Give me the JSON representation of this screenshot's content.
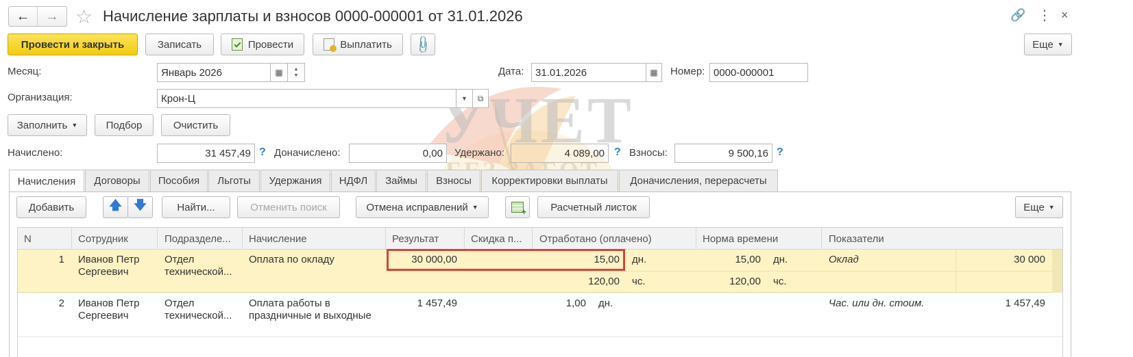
{
  "window": {
    "title": "Начисление зарплаты и взносов 0000-000001 от 31.01.2026"
  },
  "toolbar": {
    "post_close": "Провести и закрыть",
    "save": "Записать",
    "post": "Провести",
    "pay": "Выплатить",
    "more": "Еще"
  },
  "form": {
    "month_label": "Месяц:",
    "month_value": "Январь 2026",
    "date_label": "Дата:",
    "date_value": "31.01.2026",
    "number_label": "Номер:",
    "number_value": "0000-000001",
    "org_label": "Организация:",
    "org_value": "Крон-Ц"
  },
  "actions": {
    "fill": "Заполнить",
    "select": "Подбор",
    "clear": "Очистить"
  },
  "totals": {
    "accrued_label": "Начислено:",
    "accrued_value": "31 457,49",
    "extra_label": "Доначислено:",
    "extra_value": "0,00",
    "withheld_label": "Удержано:",
    "withheld_value": "4 089,00",
    "contrib_label": "Взносы:",
    "contrib_value": "9 500,16",
    "help": "?"
  },
  "tabs": [
    "Начисления",
    "Договоры",
    "Пособия",
    "Льготы",
    "Удержания",
    "НДФЛ",
    "Займы",
    "Взносы",
    "Корректировки выплаты",
    "Доначисления, перерасчеты"
  ],
  "table_toolbar": {
    "add": "Добавить",
    "find": "Найти...",
    "cancel_search": "Отменить поиск",
    "undo_fix": "Отмена исправлений",
    "payslip": "Расчетный листок",
    "more": "Еще"
  },
  "table": {
    "headers": [
      "N",
      "Сотрудник",
      "Подразделе...",
      "Начисление",
      "Результат",
      "Скидка п...",
      "Отработано (оплачено)",
      "Норма времени",
      "Показатели"
    ],
    "rows": [
      {
        "n": "1",
        "employee": [
          "Иванов Петр",
          "Сергеевич"
        ],
        "dept": [
          "Отдел",
          "технической..."
        ],
        "accrual": [
          "Оплата по окладу"
        ],
        "result": "30 000,00",
        "worked_days": "15,00",
        "worked_days_unit": "дн.",
        "worked_hours": "120,00",
        "worked_hours_unit": "чс.",
        "norm_days": "15,00",
        "norm_days_unit": "дн.",
        "norm_hours": "120,00",
        "norm_hours_unit": "чс.",
        "indicator_name": "Оклад",
        "indicator_value": "30 000"
      },
      {
        "n": "2",
        "employee": [
          "Иванов Петр",
          "Сергеевич"
        ],
        "dept": [
          "Отдел",
          "технической..."
        ],
        "accrual": [
          "Оплата работы в",
          "праздничные и выходные"
        ],
        "result": "1 457,49",
        "worked_days": "1,00",
        "worked_days_unit": "дн.",
        "indicator_name": "Час. или дн. стоим.",
        "indicator_value": "1 457,49"
      }
    ]
  },
  "watermark": {
    "line1": "УЧЕТ",
    "line2": "БЕЗ ЗАБОТ"
  },
  "colors": {
    "primary_button": "#f5d21c",
    "selected_row": "#fdf3c4",
    "highlight_box": "#d0463a",
    "help_icon": "#2b7fd0"
  }
}
